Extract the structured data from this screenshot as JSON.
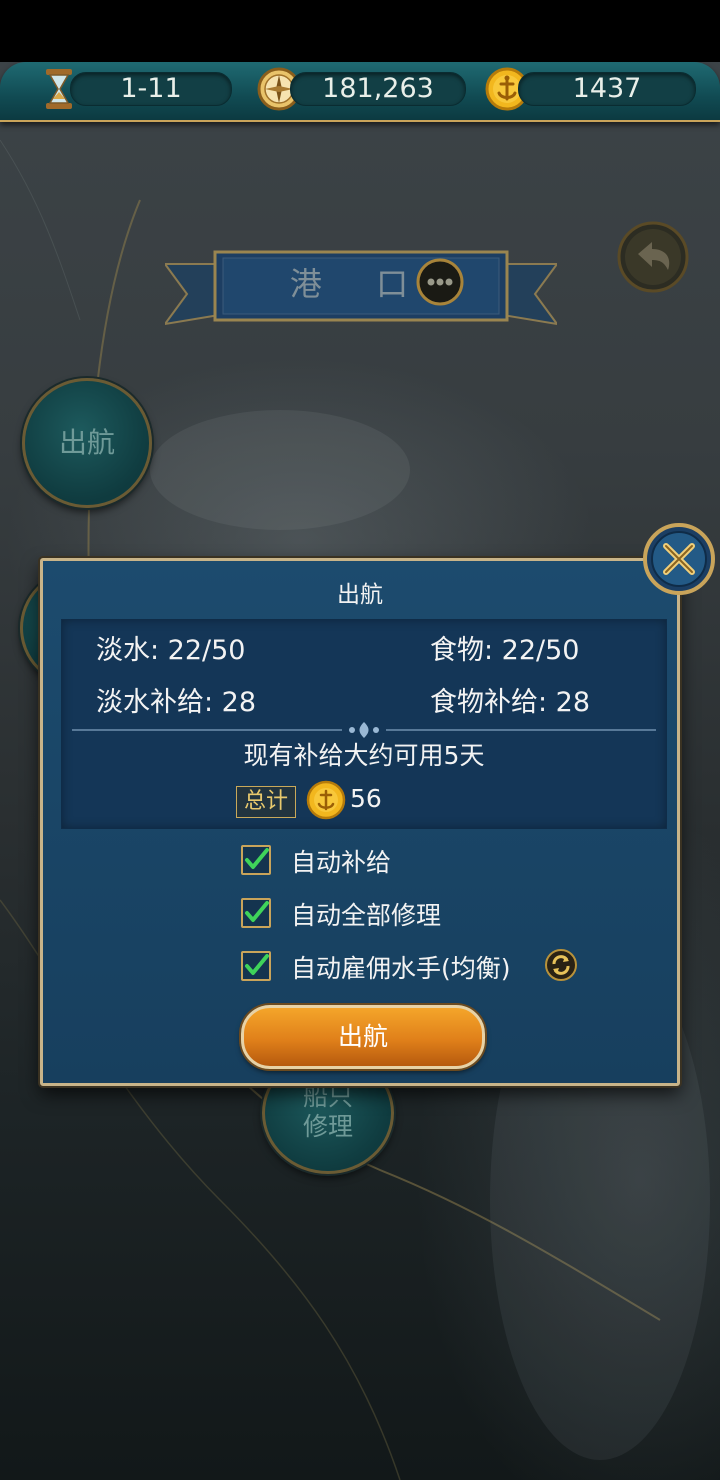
{
  "topbar": {
    "date": "1-11",
    "compass_value": "181,263",
    "coins": "1437",
    "icons": [
      "hourglass-icon",
      "compass-icon",
      "anchor-coin-icon"
    ]
  },
  "header": {
    "title": "港 口"
  },
  "side_menu": {
    "sail": "出航",
    "repair_line1": "船只",
    "repair_line2": "修理"
  },
  "dialog": {
    "title": "出航",
    "water": "淡水: 22/50",
    "food": "食物: 22/50",
    "water_supply": "淡水补给: 28",
    "food_supply": "食物补给: 28",
    "days_text": "现有补给大约可用5天",
    "total_label": "总计",
    "total_value": "56",
    "options": [
      {
        "label": "自动补给",
        "checked": true
      },
      {
        "label": "自动全部修理",
        "checked": true
      },
      {
        "label": "自动雇佣水手(均衡)",
        "checked": true
      }
    ],
    "sail_button": "出航"
  },
  "colors": {
    "accent_gold": "#c9a45a",
    "dialog_blue": "#1c4b6e",
    "button_orange": "#e0801a",
    "check_green": "#3fd35a"
  }
}
